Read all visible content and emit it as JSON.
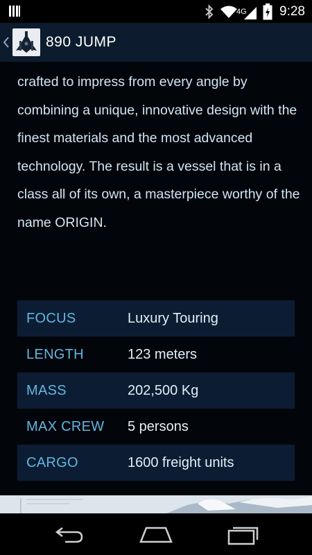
{
  "status_bar": {
    "network_type": "4G",
    "time": "9:28"
  },
  "action_bar": {
    "title": "890 JUMP",
    "app_icon": "ship-icon",
    "up_icon": "chevron-left-icon"
  },
  "description": {
    "text": "crafted to impress from every angle by combining a unique, innovative design with the finest materials and the most advanced technology. The result is a vessel that is in a class all of its own, a masterpiece worthy of the name ORIGIN."
  },
  "specs": [
    {
      "label": "FOCUS",
      "value": "Luxury Touring"
    },
    {
      "label": "LENGTH",
      "value": "123 meters"
    },
    {
      "label": "MASS",
      "value": "202,500 Kg"
    },
    {
      "label": "MAX CREW",
      "value": "5 persons"
    },
    {
      "label": "CARGO",
      "value": "1600 freight units"
    }
  ],
  "colors": {
    "action_bar_bg": "#0c1c2e",
    "page_bg": "#02060b",
    "spec_label": "#63b6e0",
    "spec_row_shaded": "#0c1d33",
    "text": "#d3e4f2"
  },
  "nav_bar": {
    "back_icon": "back-arrow-icon",
    "home_icon": "home-icon",
    "recents_icon": "recents-icon"
  }
}
